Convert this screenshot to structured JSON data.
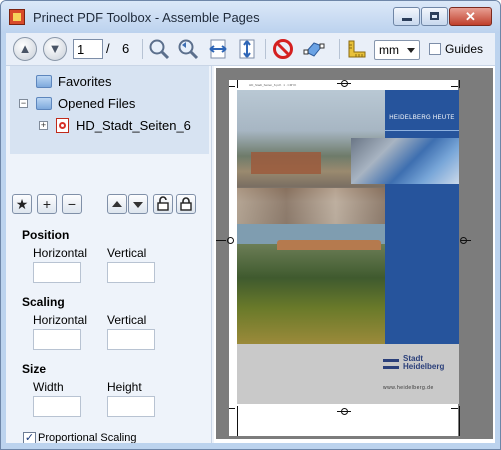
{
  "window": {
    "title": "Prinect PDF Toolbox - Assemble Pages"
  },
  "toolbar": {
    "page_current": "1",
    "page_sep": "/",
    "page_total": "6",
    "unit_value": "mm",
    "guides_label": "Guides",
    "guides_checked": false
  },
  "tree": {
    "favorites_label": "Favorites",
    "opened_files_label": "Opened Files",
    "file_label": "HD_Stadt_Seiten_6"
  },
  "panel_buttons": {
    "star": "★",
    "plus": "+",
    "minus": "−"
  },
  "properties": {
    "position": {
      "title": "Position",
      "horizontal_label": "Horizontal",
      "vertical_label": "Vertical",
      "horizontal_value": "",
      "vertical_value": ""
    },
    "scaling": {
      "title": "Scaling",
      "horizontal_label": "Horizontal",
      "vertical_label": "Vertical",
      "horizontal_value": "",
      "vertical_value": ""
    },
    "size": {
      "title": "Size",
      "width_label": "Width",
      "height_label": "Height",
      "width_value": "",
      "height_value": ""
    },
    "proportional_label": "Proportional Scaling",
    "proportional_checked": true
  },
  "preview": {
    "band_title": "HEIDELBERG HEUTE",
    "logo_text_1": "Stadt",
    "logo_text_2": "Heidelberg",
    "logo_url": "www.heidelberg.de"
  },
  "icons": [
    "nav-up-icon",
    "nav-down-icon",
    "zoom-in-icon",
    "zoom-out-icon",
    "fit-width-icon",
    "fit-height-icon",
    "no-entry-icon",
    "transform-icon",
    "ruler-icon",
    "lock-open-icon",
    "lock-closed-icon"
  ],
  "colors": {
    "accent_blue": "#26549c",
    "window_frame": "#bcd3ee"
  }
}
